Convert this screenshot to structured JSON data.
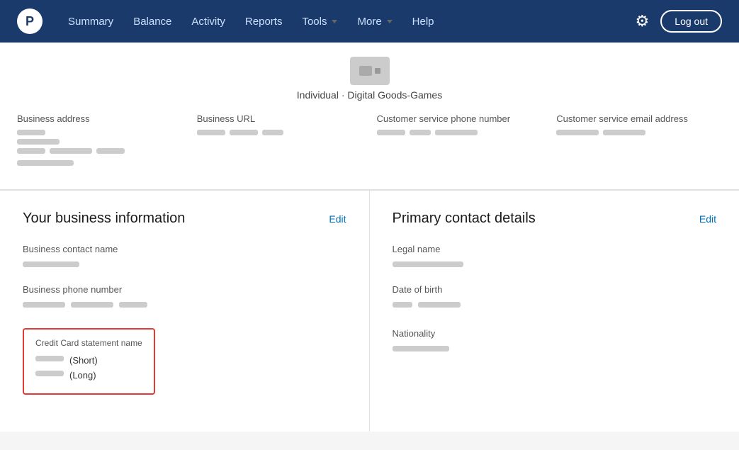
{
  "nav": {
    "logo_text": "P",
    "links": [
      {
        "id": "summary",
        "label": "Summary",
        "active": false
      },
      {
        "id": "balance",
        "label": "Balance",
        "active": false
      },
      {
        "id": "activity",
        "label": "Activity",
        "active": false
      },
      {
        "id": "reports",
        "label": "Reports",
        "active": false
      },
      {
        "id": "tools",
        "label": "Tools",
        "has_dropdown": true
      },
      {
        "id": "more",
        "label": "More",
        "has_dropdown": true
      },
      {
        "id": "help",
        "label": "Help",
        "active": false
      }
    ],
    "logout_label": "Log out",
    "gear_icon": "⚙"
  },
  "profile": {
    "subtitle": "Individual · Digital Goods-Games",
    "fields": [
      {
        "id": "business-address",
        "label": "Business address"
      },
      {
        "id": "business-url",
        "label": "Business URL"
      },
      {
        "id": "customer-phone",
        "label": "Customer service phone number"
      },
      {
        "id": "customer-email",
        "label": "Customer service email address"
      }
    ]
  },
  "business_card": {
    "title": "Your business information",
    "edit_label": "Edit",
    "fields": [
      {
        "id": "business-contact-name",
        "label": "Business contact name"
      },
      {
        "id": "business-phone",
        "label": "Business phone number"
      }
    ],
    "cc_statement": {
      "label": "Credit Card statement name",
      "short_label": "(Short)",
      "long_label": "(Long)"
    }
  },
  "contact_card": {
    "title": "Primary contact details",
    "edit_label": "Edit",
    "fields": [
      {
        "id": "legal-name",
        "label": "Legal name"
      },
      {
        "id": "dob",
        "label": "Date of birth"
      },
      {
        "id": "nationality",
        "label": "Nationality"
      }
    ]
  }
}
